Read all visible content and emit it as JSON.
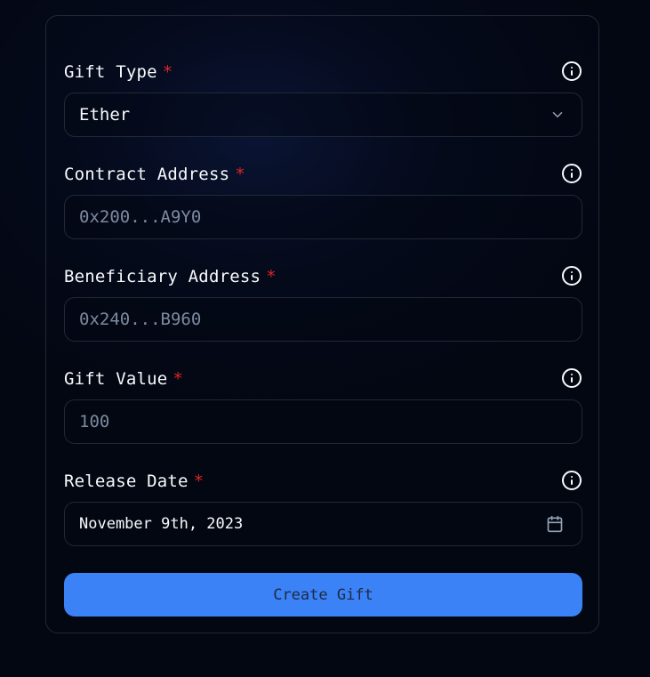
{
  "form": {
    "gift_type": {
      "label": "Gift Type",
      "required_marker": "*",
      "value": "Ether",
      "icon": "chevron-down-icon"
    },
    "contract_address": {
      "label": "Contract Address",
      "required_marker": "*",
      "placeholder": "0x200...A9Y0"
    },
    "beneficiary_address": {
      "label": "Beneficiary Address",
      "required_marker": "*",
      "placeholder": "0x240...B960"
    },
    "gift_value": {
      "label": "Gift Value",
      "required_marker": "*",
      "placeholder": "100"
    },
    "release_date": {
      "label": "Release Date",
      "required_marker": "*",
      "value": "November 9th, 2023",
      "icon": "calendar-icon"
    },
    "submit_label": "Create Gift"
  },
  "colors": {
    "background": "#030712",
    "border": "#1f2937",
    "accent": "#3b82f6",
    "required": "#dc2626",
    "placeholder": "#7c8aa0",
    "text": "#f8fafc"
  }
}
